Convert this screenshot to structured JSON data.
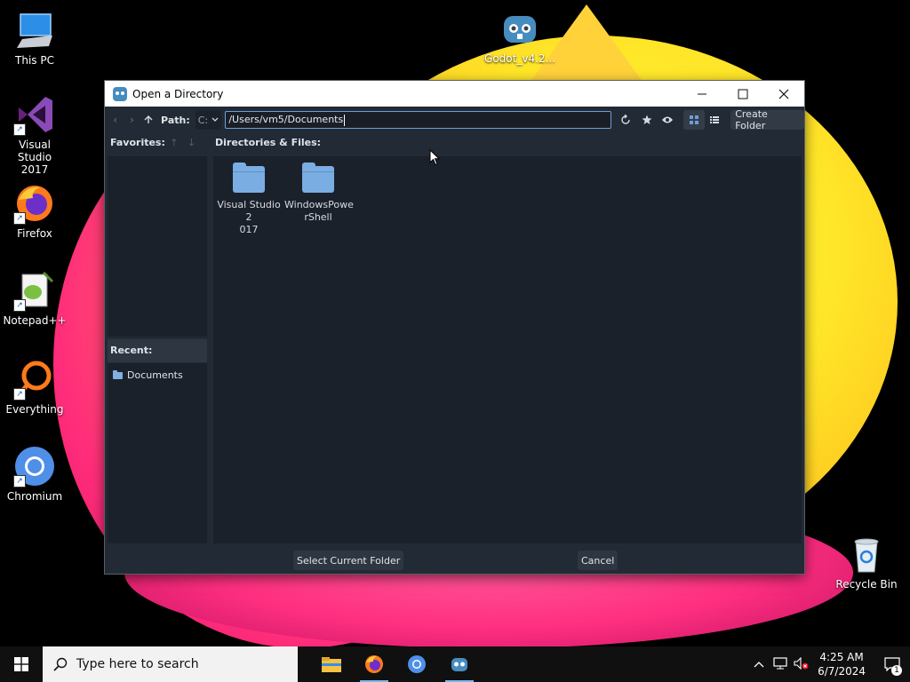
{
  "desktop": {
    "icons": [
      {
        "label": "This PC"
      },
      {
        "label": "Visual Studio 2017"
      },
      {
        "label": "Firefox"
      },
      {
        "label": "Notepad++"
      },
      {
        "label": "Everything"
      },
      {
        "label": "Chromium"
      },
      {
        "label": "Godot_v4.2..."
      },
      {
        "label": "Recycle Bin"
      }
    ]
  },
  "dialog": {
    "title": "Open a Directory",
    "path_label": "Path:",
    "drive": "C:",
    "path_value": "/Users/vm5/Documents",
    "create_folder_label": "Create Folder",
    "favorites_label": "Favorites:",
    "dirs_label": "Directories & Files:",
    "recent_label": "Recent:",
    "recent_items": [
      "Documents"
    ],
    "files": [
      {
        "name": "Visual Studio 2\n017"
      },
      {
        "name": "WindowsPowe\nrShell"
      }
    ],
    "select_button": "Select Current Folder",
    "cancel_button": "Cancel"
  },
  "taskbar": {
    "search_placeholder": "Type here to search",
    "time": "4:25 AM",
    "date": "6/7/2024",
    "notification_count": "1"
  },
  "colors": {
    "window_bg": "#222a35",
    "panel_bg": "#1b212b",
    "folder": "#7aaee3",
    "accent": "#6d9fd8"
  }
}
